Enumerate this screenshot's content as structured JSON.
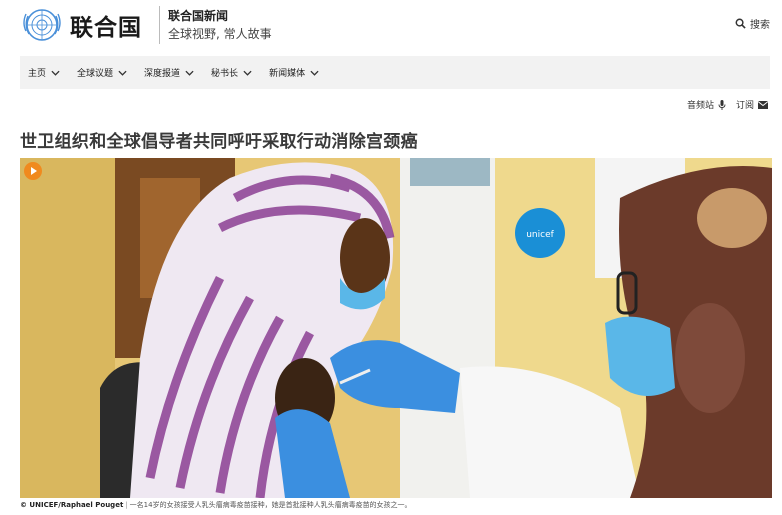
{
  "header": {
    "logo_text": "联合国",
    "news_title": "联合国新闻",
    "news_subtitle": "全球视野, 常人故事",
    "search_label": "搜索"
  },
  "nav": {
    "items": [
      {
        "label": "主页"
      },
      {
        "label": "全球议题"
      },
      {
        "label": "深度报道"
      },
      {
        "label": "秘书长"
      },
      {
        "label": "新闻媒体"
      }
    ]
  },
  "tools": {
    "audio_label": "音频站",
    "subscribe_label": "订阅"
  },
  "article": {
    "headline": "世卫组织和全球倡导者共同呼吁采取行动消除宫颈癌",
    "photo_credit": "© UNICEF/Raphael Pouget",
    "photo_caption": "一名14岁的女孩接受人乳头瘤病毒疫苗接种，她是首批接种人乳头瘤病毒疫苗的女孩之一。"
  },
  "icons": {
    "logo": "un-emblem-icon",
    "search": "search-icon",
    "audio": "microphone-icon",
    "subscribe": "envelope-icon",
    "play": "play-icon",
    "nav_chevron": "chevron-down-icon"
  },
  "colors": {
    "logo_blue": "#4a90d9",
    "play_orange": "#f08a1e",
    "nav_bg": "#f2f2f2",
    "unicef_blue": "#1a8fd6"
  }
}
